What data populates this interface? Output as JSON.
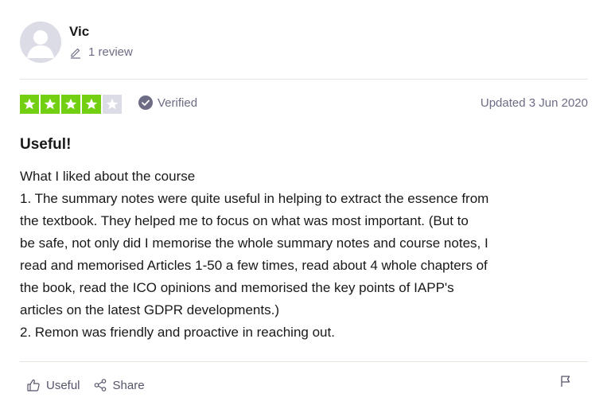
{
  "reviewer": {
    "name": "Vic",
    "review_count": "1 review"
  },
  "rating": {
    "stars_filled": 4,
    "stars_total": 5,
    "star_color": "#73cf11",
    "empty_star_color": "#dcdce6"
  },
  "verified_label": "Verified",
  "date": "Updated 3 Jun 2020",
  "review": {
    "title": "Useful!",
    "lines": [
      "What I liked about the course",
      "1. The summary notes were quite useful in helping to extract the essence from",
      "the textbook. They helped me to focus on what was most important. (But to",
      "be safe, not only did I memorise the whole summary notes and course notes, I",
      "read and memorised Articles 1-50 a few times, read about 4 whole chapters of",
      "the book, read the ICO opinions and memorised the key points of IAPP's",
      "articles on the latest GDPR developments.)",
      "2. Remon was friendly and proactive in reaching out."
    ]
  },
  "actions": {
    "useful_label": "Useful",
    "share_label": "Share"
  },
  "icons": {
    "avatar": "user-silhouette-icon",
    "review_count": "pencil-icon",
    "verified": "check-circle-icon",
    "useful": "thumbs-up-icon",
    "share": "share-icon",
    "report": "flag-icon"
  }
}
